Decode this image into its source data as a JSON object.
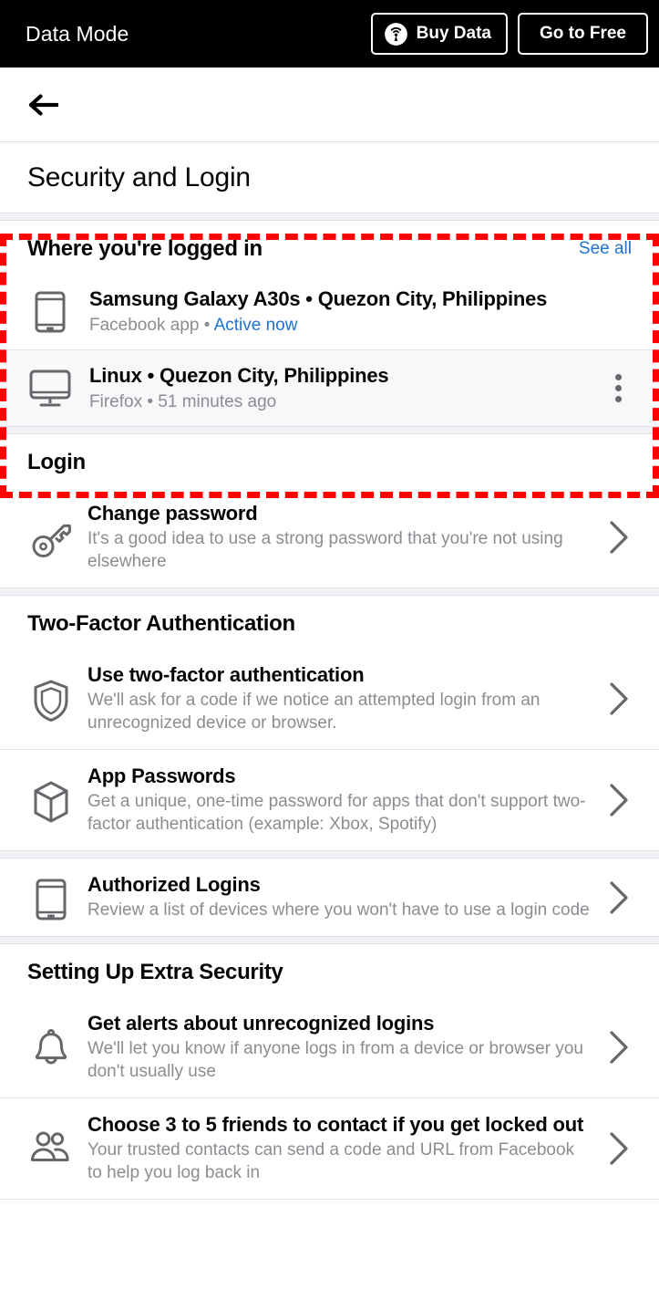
{
  "databar": {
    "title": "Data Mode",
    "buy_label": "Buy Data",
    "buy_icon": "broadcast-icon",
    "free_label": "Go to Free"
  },
  "nav": {
    "back_icon": "back-arrow-icon"
  },
  "page": {
    "title": "Security and Login"
  },
  "logged_in_section": {
    "heading": "Where you're logged in",
    "see_all": "See all",
    "devices": [
      {
        "icon": "mobile-phone-icon",
        "title": "Samsung Galaxy A30s • Quezon City, Philippines",
        "sub_prefix": "Facebook app • ",
        "sub_link": "Active now",
        "has_menu": false
      },
      {
        "icon": "desktop-monitor-icon",
        "title": "Linux • Quezon City, Philippines",
        "sub_prefix": "Firefox • 51 minutes ago",
        "sub_link": "",
        "has_menu": true,
        "menu_icon": "kebab-menu-icon"
      }
    ]
  },
  "login_section": {
    "heading": "Login",
    "items": [
      {
        "icon": "key-icon",
        "title": "Change password",
        "desc": "It's a good idea to use a strong password that you're not using elsewhere",
        "chevron": "chevron-right-icon"
      }
    ]
  },
  "two_factor_section": {
    "heading": "Two-Factor Authentication",
    "items": [
      {
        "icon": "shield-icon",
        "title": "Use two-factor authentication",
        "desc": "We'll ask for a code if we notice an attempted login from an unrecognized device or browser.",
        "chevron": "chevron-right-icon"
      },
      {
        "icon": "cube-icon",
        "title": "App Passwords",
        "desc": "Get a unique, one-time password for apps that don't support two-factor authentication (example: Xbox, Spotify)",
        "chevron": "chevron-right-icon"
      },
      {
        "icon": "mobile-phone-icon",
        "title": "Authorized Logins",
        "desc": "Review a list of devices where you won't have to use a login code",
        "chevron": "chevron-right-icon"
      }
    ]
  },
  "extra_security_section": {
    "heading": "Setting Up Extra Security",
    "items": [
      {
        "icon": "bell-icon",
        "title": "Get alerts about unrecognized logins",
        "desc": "We'll let you know if anyone logs in from a device or browser you don't usually use",
        "chevron": "chevron-right-icon"
      },
      {
        "icon": "friends-icon",
        "title": "Choose 3 to 5 friends to contact if you get locked out",
        "desc": "Your trusted contacts can send a code and URL from Facebook to help you log back in",
        "chevron": "chevron-right-icon"
      }
    ]
  },
  "colors": {
    "accent_link": "#2072d0",
    "annotation": "#ff0000",
    "text_primary": "#050505",
    "text_secondary": "#8a8d91",
    "databar_bg": "#000000"
  }
}
